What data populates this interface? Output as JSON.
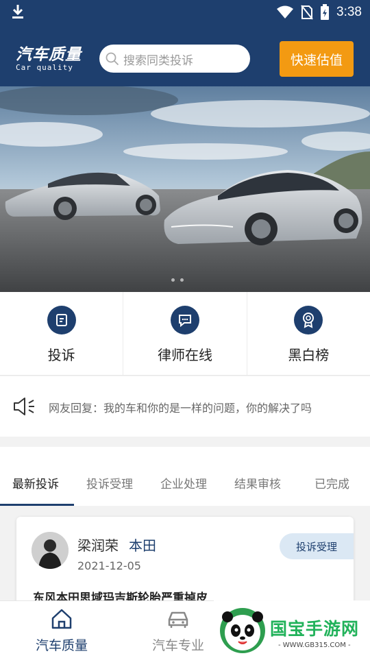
{
  "status_bar": {
    "time": "3:38"
  },
  "header": {
    "logo_cn": "汽车质量",
    "logo_en": "Car quality",
    "search_placeholder": "搜索同类投诉",
    "quick_button": "快速估值"
  },
  "banner": {
    "slides": 2,
    "active_slide": 0
  },
  "quick_nav": [
    {
      "label": "投诉",
      "icon": "document-icon"
    },
    {
      "label": "律师在线",
      "icon": "chat-icon"
    },
    {
      "label": "黑白榜",
      "icon": "medal-icon"
    }
  ],
  "notice": {
    "icon": "speaker-icon",
    "text": "网友回复：我的车和你的是一样的问题，你的解决了吗"
  },
  "tabs": [
    "最新投诉",
    "投诉受理",
    "企业处理",
    "结果审核",
    "已完成"
  ],
  "active_tab": 0,
  "complaint": {
    "user": "梁润荣",
    "brand": "本田",
    "date": "2021-12-05",
    "status": "投诉受理",
    "title": "东风本田思域玛吉斯轮胎严重掉皮"
  },
  "bottom_nav": [
    {
      "label": "汽车质量",
      "icon": "home-icon",
      "active": true
    },
    {
      "label": "汽车专业",
      "icon": "car-icon",
      "active": false
    }
  ],
  "watermark": {
    "text": "国宝手游网",
    "url": "- WWW.GB315.COM -"
  },
  "colors": {
    "primary": "#1e3f6e",
    "accent": "#f39a12",
    "badge_bg": "#dbe8f4"
  }
}
